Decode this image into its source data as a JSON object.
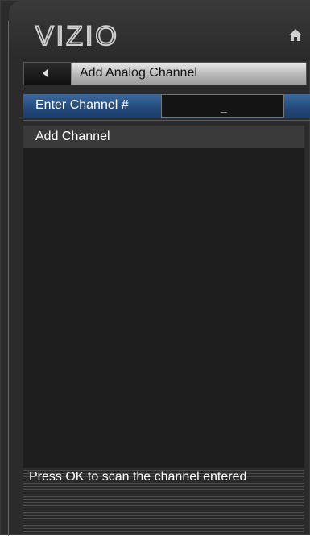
{
  "header": {
    "logo": "VIZIO",
    "home_icon": "home-icon"
  },
  "nav": {
    "back_icon": "back-arrow-icon",
    "title": "Add Analog Channel"
  },
  "entry": {
    "label": "Enter Channel #",
    "value": "_"
  },
  "menu": {
    "items": [
      {
        "label": "Add Channel"
      }
    ]
  },
  "status": {
    "text": "Press OK to scan the channel entered"
  },
  "colors": {
    "selected": "#23497a",
    "background": "#1e1e1e"
  }
}
